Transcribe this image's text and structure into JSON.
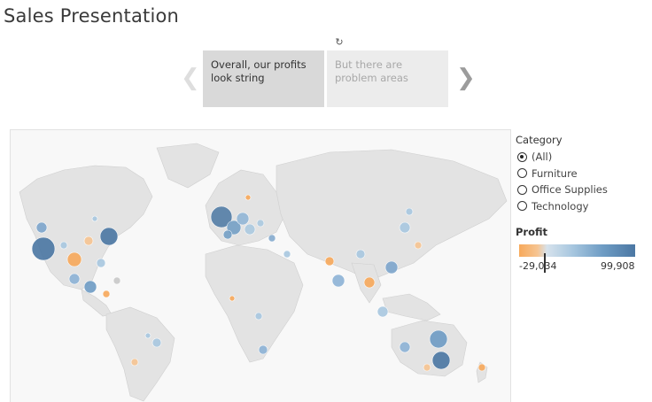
{
  "title": "Sales Presentation",
  "story": {
    "points": [
      {
        "label": "Overall, our profits look string",
        "selected": true
      },
      {
        "label": "But there are problem areas",
        "selected": false
      }
    ],
    "prev_icon": "chevron-left-icon",
    "next_icon": "chevron-right-icon",
    "reload_icon": "reload-icon"
  },
  "filter": {
    "title": "Category",
    "options": [
      {
        "label": "(All)",
        "selected": true
      },
      {
        "label": "Furniture",
        "selected": false
      },
      {
        "label": "Office Supplies",
        "selected": false
      },
      {
        "label": "Technology",
        "selected": false
      }
    ]
  },
  "profit_legend": {
    "title": "Profit",
    "min_label": "-29,034",
    "max_label": "99,908",
    "colors": {
      "negative": "#f7a95b",
      "positive": "#4b77a3"
    }
  }
}
